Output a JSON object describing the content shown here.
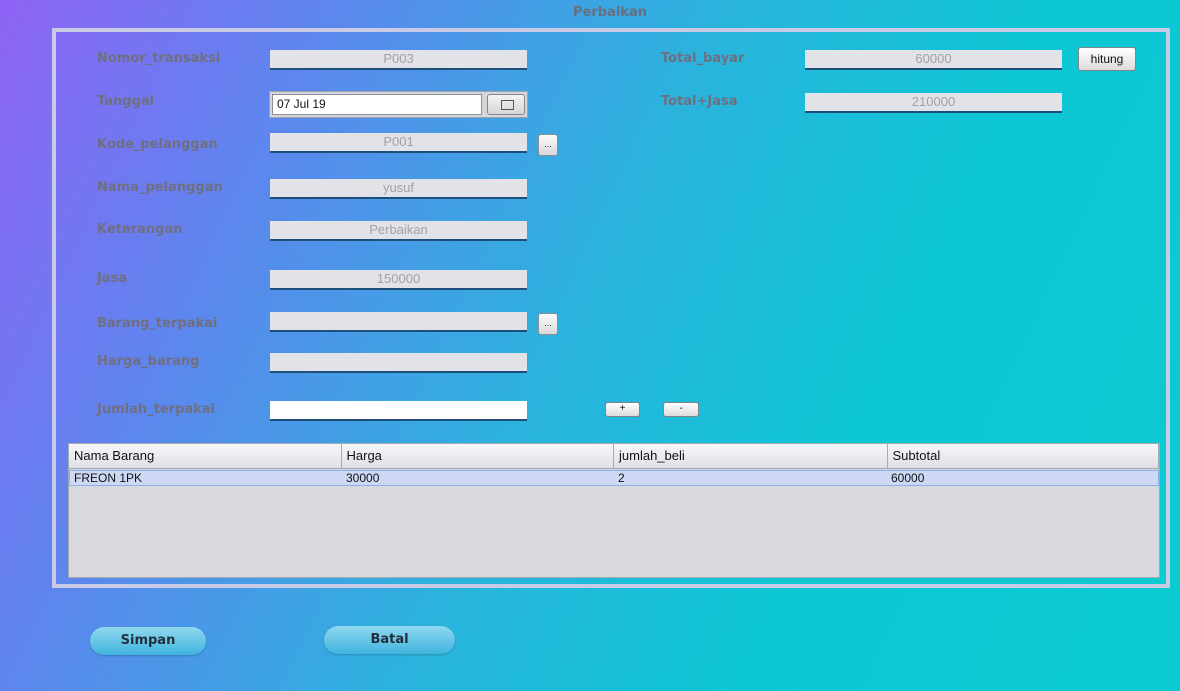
{
  "window": {
    "title": "Perbaikan"
  },
  "form": {
    "nomor_transaksi": {
      "label": "Nomor_transaksi",
      "value": "P003"
    },
    "tanggal": {
      "label": "Tanggal",
      "value": "07 Jul 19",
      "picker_icon": "calendar-icon"
    },
    "kode_pelanggan": {
      "label": "Kode_pelanggan",
      "value": "P001",
      "browse_label": "..."
    },
    "nama_pelanggan": {
      "label": "Nama_pelanggan",
      "value": "yusuf"
    },
    "keterangan": {
      "label": "Keterangan",
      "value": "Perbaikan"
    },
    "jasa": {
      "label": "Jasa",
      "value": "150000"
    },
    "barang_terpakai": {
      "label": "Barang_terpakai",
      "value": "",
      "browse_label": "..."
    },
    "harga_barang": {
      "label": "Harga_barang",
      "value": ""
    },
    "jumlah_terpakai": {
      "label": "Jumlah_terpakai",
      "value": ""
    },
    "total_bayar": {
      "label": "Total_bayar",
      "value": "60000"
    },
    "total_jasa": {
      "label": "Total+Jasa",
      "value": "210000"
    }
  },
  "buttons": {
    "hitung": "hitung",
    "add": "+",
    "remove": "-",
    "simpan": "Simpan",
    "batal": "Batal"
  },
  "table": {
    "columns": [
      "Nama Barang",
      "Harga",
      "jumlah_beli",
      "Subtotal"
    ],
    "rows": [
      [
        "FREON 1PK",
        "30000",
        "2",
        "60000"
      ]
    ]
  }
}
